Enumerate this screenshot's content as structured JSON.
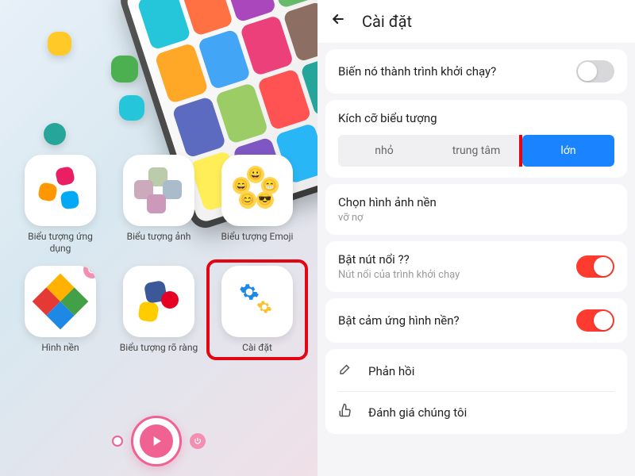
{
  "left": {
    "tiles": [
      {
        "label": "Biểu tượng ứng dụng",
        "name": "app-icon-tile"
      },
      {
        "label": "Biểu tượng ảnh",
        "name": "photo-icon-tile"
      },
      {
        "label": "Biểu tượng Emoji",
        "name": "emoji-icon-tile"
      },
      {
        "label": "Hình nền",
        "name": "wallpaper-tile"
      },
      {
        "label": "Biểu tượng rõ ràng",
        "name": "clear-icon-tile"
      },
      {
        "label": "Cài đặt",
        "name": "settings-tile"
      }
    ]
  },
  "right": {
    "title": "Cài đặt",
    "make_launcher": {
      "label": "Biến nó thành trình khởi chạy?",
      "on": false
    },
    "icon_size": {
      "label": "Kích cỡ biểu tượng",
      "options": {
        "small": "nhỏ",
        "medium": "trung tâm",
        "large": "lớn"
      },
      "selected": "large"
    },
    "wallpaper_select": {
      "label": "Chọn hình ảnh nền",
      "value": "vỡ nợ"
    },
    "float_button": {
      "label": "Bật nút nổi ??",
      "sub": "Nút nổi của trình khởi chạy",
      "on": true
    },
    "wallpaper_touch": {
      "label": "Bật cảm ứng hình nền?",
      "on": true
    },
    "feedback": "Phản hồi",
    "rate": "Đánh giá chúng tôi"
  }
}
